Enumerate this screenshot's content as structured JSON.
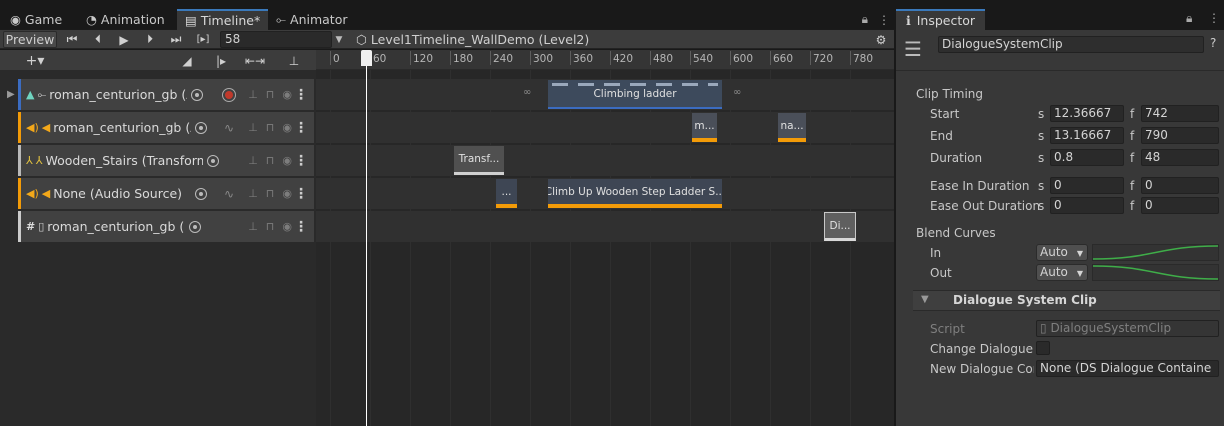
{
  "tabs": {
    "game": "Game",
    "animation": "Animation",
    "timeline": "Timeline*",
    "animator": "Animator"
  },
  "toolbar": {
    "preview": "Preview",
    "frame": "58",
    "timeline_name": "Level1Timeline_WallDemo (Level2)"
  },
  "ruler": {
    "ticks": [
      "0",
      "60",
      "120",
      "180",
      "240",
      "300",
      "360",
      "420",
      "480",
      "540",
      "600",
      "660",
      "720",
      "780"
    ],
    "playhead_frame": 58
  },
  "tracks": [
    {
      "name": "roman_centurion_gb (Ar",
      "type": "animation",
      "color": "#3b6cc1"
    },
    {
      "name": "roman_centurion_gb (Au",
      "type": "audio",
      "color": "#f39b08"
    },
    {
      "name": "Wooden_Stairs (Transform)",
      "type": "transform",
      "color": "#b9b9b9"
    },
    {
      "name": "None (Audio Source)",
      "type": "audio",
      "color": "#f39b08"
    },
    {
      "name": "roman_centurion_gb (DS Dia",
      "type": "dialogue",
      "color": "#cccccc"
    }
  ],
  "clips": {
    "climbing_ladder": "Climbing ladder",
    "audio_m": "m...",
    "audio_na": "na...",
    "transform": "Transf...",
    "small_audio": "...",
    "climb_up": "Climb Up Wooden Step Ladder S...",
    "dialogue": "Di..."
  },
  "inspector": {
    "tab": "Inspector",
    "clip_name": "DialogueSystemClip",
    "clip_timing": "Clip Timing",
    "start": {
      "label": "Start",
      "s": "12.36667",
      "f": "742"
    },
    "end": {
      "label": "End",
      "s": "13.16667",
      "f": "790"
    },
    "duration": {
      "label": "Duration",
      "s": "0.8",
      "f": "48"
    },
    "ease_in": {
      "label": "Ease In Duration",
      "s": "0",
      "f": "0"
    },
    "ease_out": {
      "label": "Ease Out Duration",
      "s": "0",
      "f": "0"
    },
    "s_label": "s",
    "f_label": "f",
    "blend_curves": "Blend Curves",
    "blend_in": {
      "label": "In",
      "value": "Auto"
    },
    "blend_out": {
      "label": "Out",
      "value": "Auto"
    },
    "section": "Dialogue System Clip",
    "script_label": "Script",
    "script_value": "DialogueSystemClip",
    "change_dialogue_label": "Change Dialogue",
    "new_dialogue_label": "New Dialogue Con",
    "new_dialogue_value": "None (DS Dialogue Containe"
  }
}
